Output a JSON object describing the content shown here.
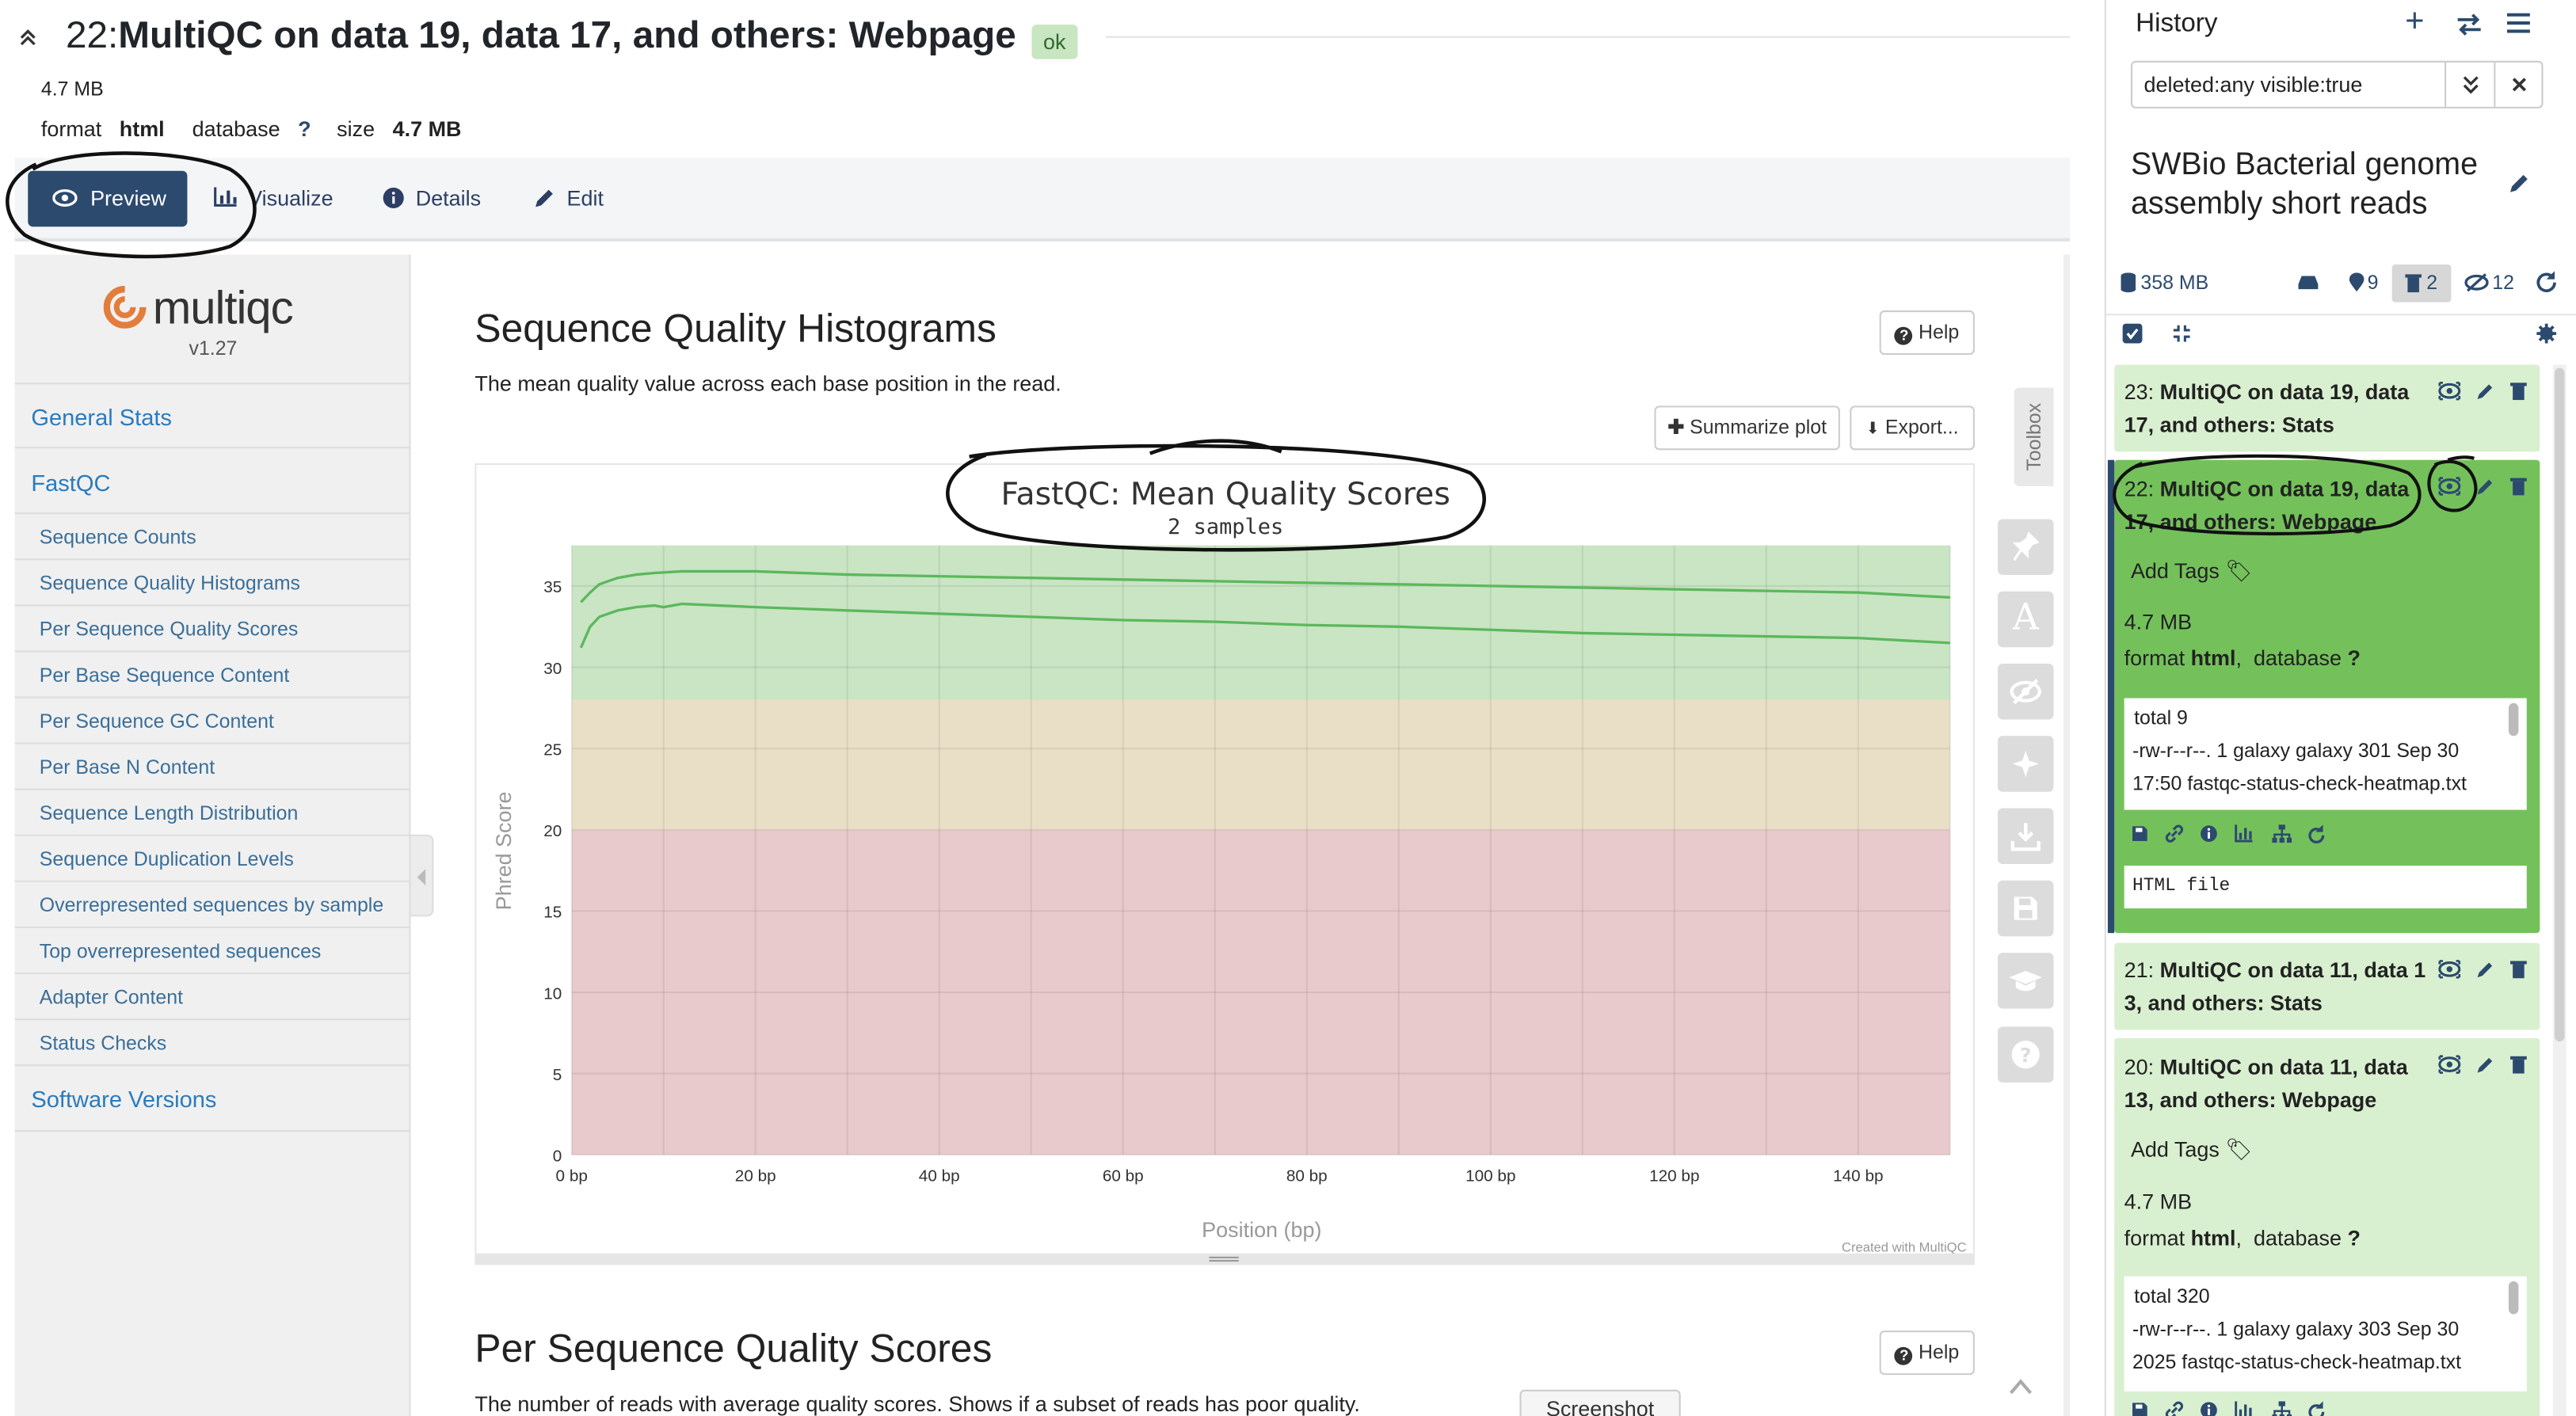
{
  "dataset": {
    "hid": "22:",
    "name": "MultiQC on data 19, data 17, and others: Webpage",
    "state_badge": "ok",
    "size_line": "4.7 MB",
    "format_label": "format",
    "format_value": "html",
    "database_label": "database",
    "database_value": "?",
    "size_label": "size",
    "size_value": "4.7 MB"
  },
  "tabs": {
    "preview": "Preview",
    "visualize": "Visualize",
    "details": "Details",
    "edit": "Edit"
  },
  "multiqc": {
    "logo_text": "multiqc",
    "version": "v1.27",
    "nav": {
      "general_stats": "General Stats",
      "fastqc": "FastQC",
      "sub": [
        "Sequence Counts",
        "Sequence Quality Histograms",
        "Per Sequence Quality Scores",
        "Per Base Sequence Content",
        "Per Sequence GC Content",
        "Per Base N Content",
        "Sequence Length Distribution",
        "Sequence Duplication Levels",
        "Overrepresented sequences by sample",
        "Top overrepresented sequences",
        "Adapter Content",
        "Status Checks"
      ],
      "software_versions": "Software Versions"
    },
    "section1": {
      "title": "Sequence Quality Histograms",
      "desc": "The mean quality value across each base position in the read.",
      "help": "Help",
      "summarize": "Summarize plot",
      "export": "Export..."
    },
    "section2": {
      "title": "Per Sequence Quality Scores",
      "desc": "The number of reads with average quality scores. Shows if a subset of reads has poor quality.",
      "help": "Help"
    },
    "toolbox_label": "Toolbox",
    "credit": "Created with MultiQC",
    "screenshot_tab": "Screenshot"
  },
  "chart_data": {
    "type": "line",
    "title": "FastQC: Mean Quality Scores",
    "subtitle": "2 samples",
    "xlabel": "Position (bp)",
    "ylabel": "Phred Score",
    "xlim": [
      0,
      150
    ],
    "ylim": [
      0,
      37.5
    ],
    "xticks": [
      "0 bp",
      "20 bp",
      "40 bp",
      "60 bp",
      "80 bp",
      "100 bp",
      "120 bp",
      "140 bp"
    ],
    "yticks": [
      "0",
      "5",
      "10",
      "15",
      "20",
      "25",
      "30",
      "35"
    ],
    "bands": [
      {
        "from": 28,
        "to": 37.5,
        "color": "#c9e5c4"
      },
      {
        "from": 20,
        "to": 28,
        "color": "#e9dfc6"
      },
      {
        "from": 0,
        "to": 20,
        "color": "#e8c9cc"
      }
    ],
    "line_color": "#5cb85c",
    "series": [
      {
        "x": [
          1,
          2,
          3,
          5,
          7,
          9,
          12,
          16,
          20,
          30,
          40,
          50,
          60,
          70,
          80,
          90,
          100,
          110,
          120,
          130,
          140,
          150
        ],
        "y": [
          34.0,
          34.6,
          35.1,
          35.5,
          35.7,
          35.8,
          35.9,
          35.9,
          35.9,
          35.7,
          35.6,
          35.5,
          35.4,
          35.3,
          35.2,
          35.1,
          35.0,
          34.9,
          34.8,
          34.7,
          34.6,
          34.3
        ]
      },
      {
        "x": [
          1,
          2,
          3,
          5,
          7,
          9,
          10,
          12,
          16,
          20,
          30,
          40,
          50,
          60,
          70,
          80,
          90,
          100,
          110,
          120,
          130,
          140,
          150
        ],
        "y": [
          31.2,
          32.5,
          33.1,
          33.5,
          33.7,
          33.8,
          33.7,
          33.9,
          33.8,
          33.7,
          33.5,
          33.3,
          33.1,
          32.9,
          32.8,
          32.6,
          32.5,
          32.3,
          32.1,
          32.0,
          31.9,
          31.8,
          31.5
        ]
      }
    ]
  },
  "history": {
    "title": "History",
    "filter_value": "deleted:any visible:true",
    "name": "SWBio Bacterial genome assembly short reads",
    "size": "358 MB",
    "count_shown": "9",
    "count_deleted": "2",
    "count_hidden": "12",
    "items": [
      {
        "hid": "23:",
        "line1": "MultiQC on data 19, data",
        "line2": "17, and others: Stats"
      },
      {
        "hid": "22:",
        "line1": "MultiQC on data 19, data",
        "line2": "17, and others: Webpage",
        "tags": "Add Tags",
        "size": "4.7 MB",
        "format_label": "format",
        "format_value": "html",
        "db_label": "database",
        "db_value": "?",
        "peek": [
          "total 9",
          "-rw-r--r--. 1 galaxy galaxy 301 Sep 30",
          "17:50 fastqc-status-check-heatmap.txt"
        ],
        "datatype": "HTML file"
      },
      {
        "hid": "21:",
        "line1": "MultiQC on data 11, data 1",
        "line2": "3, and others: Stats"
      },
      {
        "hid": "20:",
        "line1": "MultiQC on data 11, data",
        "line2": "13, and others: Webpage",
        "tags": "Add Tags",
        "size": "4.7 MB",
        "format_label": "format",
        "format_value": "html",
        "db_label": "database",
        "db_value": "?",
        "peek": [
          "total 320",
          "-rw-r--r--. 1 galaxy galaxy 303 Sep 30",
          "2025 fastqc-status-check-heatmap.txt"
        ]
      }
    ]
  }
}
